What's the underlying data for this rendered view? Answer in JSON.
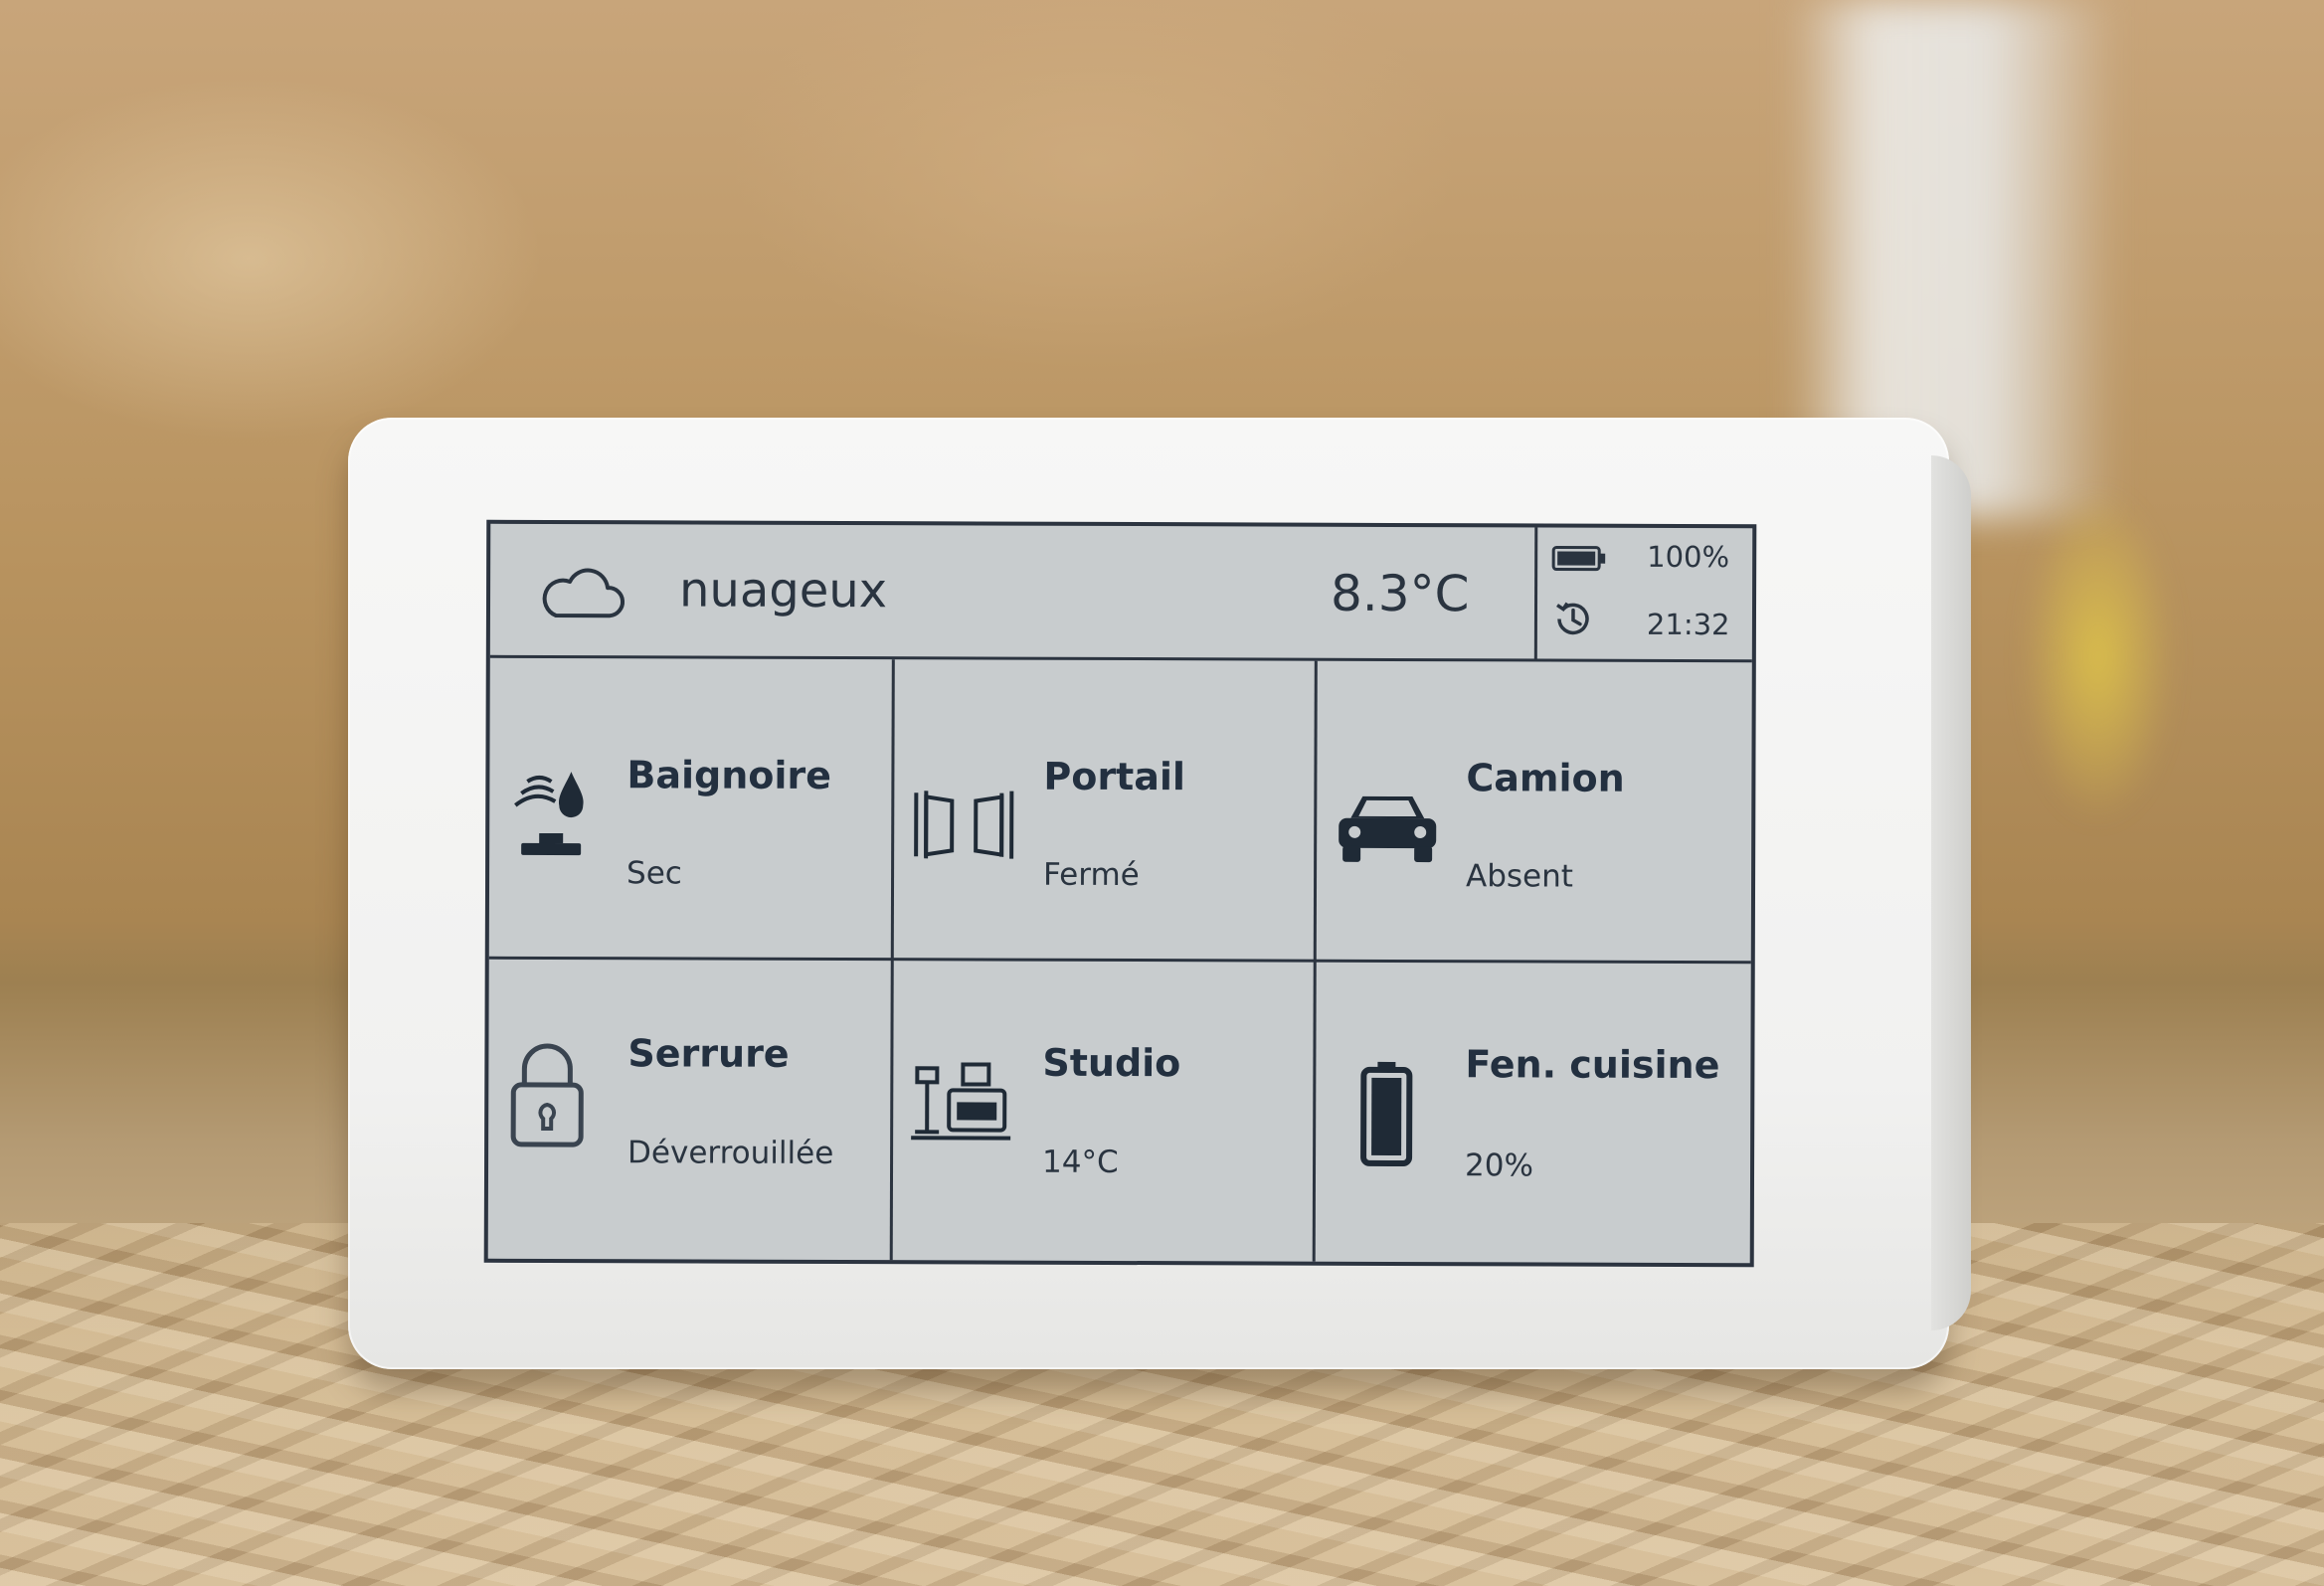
{
  "header": {
    "weather": "nuageux",
    "weather_icon": "cloud-icon",
    "temperature": "8.3°C",
    "battery": "100%",
    "battery_icon": "battery-icon",
    "time": "21:32",
    "time_icon": "clock-icon"
  },
  "tiles": [
    {
      "title": "Baignoire",
      "status": "Sec",
      "icon": "water-leak-sensor-icon"
    },
    {
      "title": "Portail",
      "status": "Fermé",
      "icon": "gate-icon"
    },
    {
      "title": "Camion",
      "status": "Absent",
      "icon": "car-icon"
    },
    {
      "title": "Serrure",
      "status": "Déverrouillée",
      "icon": "padlock-icon"
    },
    {
      "title": "Studio",
      "status": "14°C",
      "icon": "studio-room-icon"
    },
    {
      "title": "Fen. cuisine",
      "status": "20%",
      "icon": "battery-level-icon",
      "level": 0.2
    }
  ],
  "colors": {
    "screen": "#c8ccce",
    "ink": "#1f2a36",
    "frame": "#f1f1f0"
  }
}
